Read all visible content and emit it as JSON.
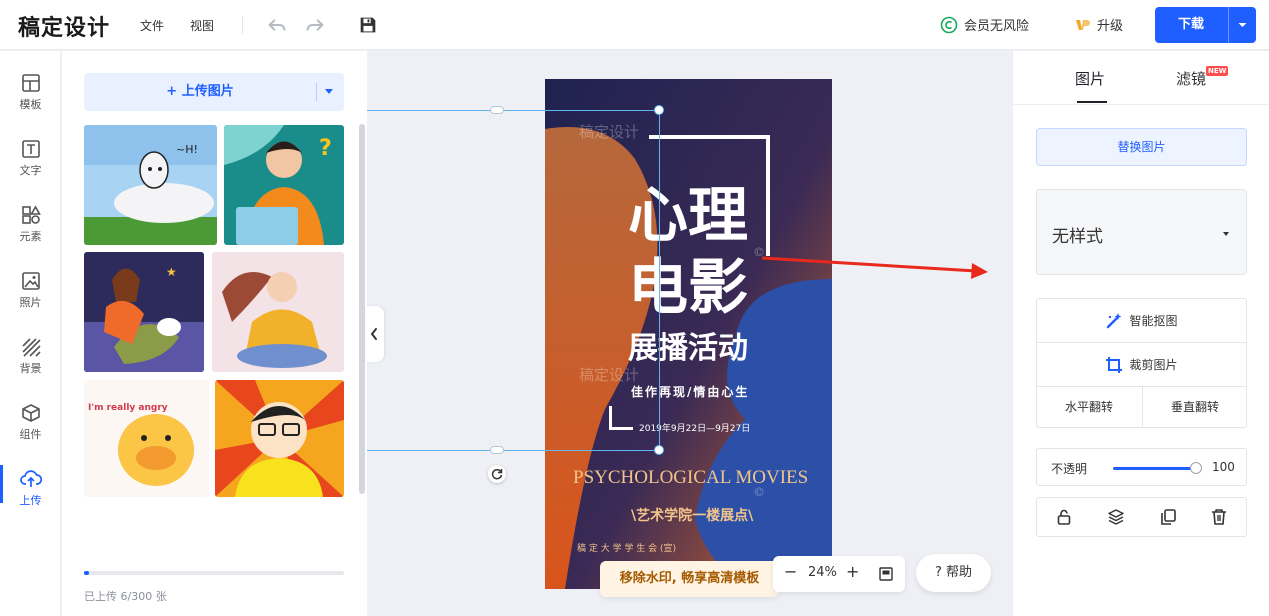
{
  "app": {
    "logo": "稿定设计"
  },
  "topbar": {
    "menu": [
      "文件",
      "视图"
    ],
    "vip_label": "会员无风险",
    "upgrade_label": "升级",
    "download_label": "下载"
  },
  "leftnav": {
    "items": [
      {
        "label": "模板",
        "icon": "template-icon"
      },
      {
        "label": "文字",
        "icon": "text-icon"
      },
      {
        "label": "元素",
        "icon": "elements-icon"
      },
      {
        "label": "照片",
        "icon": "photo-icon"
      },
      {
        "label": "背景",
        "icon": "background-icon"
      },
      {
        "label": "组件",
        "icon": "component-icon"
      },
      {
        "label": "上传",
        "icon": "upload-icon",
        "active": true
      }
    ]
  },
  "upload_panel": {
    "upload_button": "+ 上传图片",
    "progress_fraction": 0.02,
    "status": "已上传 6/300 张",
    "thumb_lettering": [
      "~H!",
      "?",
      "I'm really angry"
    ]
  },
  "poster": {
    "watermark": "稿定设计",
    "title_line1": "心理",
    "title_line2": "电影",
    "subtitle": "展播活动",
    "tagline": "佳作再现/情由心生",
    "date": "2019年9月22日—9月27日",
    "english_title": "PSYCHOLOGICAL MOVIES",
    "venue": "\\艺术学院一楼展点\\",
    "organizer": "稿 定 大 学 学 生 会 (宣)",
    "copyright_mark": "©"
  },
  "canvas_footer": {
    "watermark_tip": "移除水印, 畅享高清模板",
    "zoom_minus": "−",
    "zoom_value": "24%",
    "zoom_plus": "+",
    "help": "? 帮助"
  },
  "right_panel": {
    "tabs": [
      "图片",
      "滤镜"
    ],
    "new_badge": "NEW",
    "replace_button": "替换图片",
    "style_select": "无样式",
    "smart_cutout": "智能抠图",
    "crop": "裁剪图片",
    "flip_h": "水平翻转",
    "flip_v": "垂直翻转",
    "opacity_label": "不透明",
    "opacity_value": "100"
  },
  "colors": {
    "accent": "#1f5fff",
    "selection": "#5fb6f4",
    "annotation_arrow": "#e8291c",
    "poster_text_gold": "#f2c48a"
  }
}
